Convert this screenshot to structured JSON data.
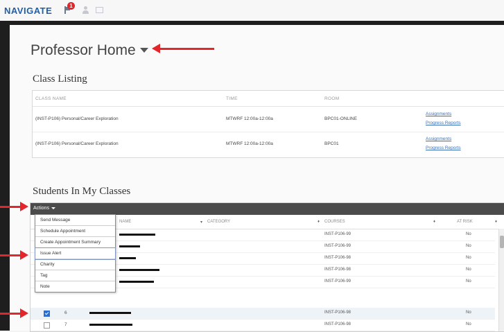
{
  "topbar": {
    "brand": "NAVIGATE",
    "badge_count": "1"
  },
  "header": {
    "title": "Professor Home"
  },
  "class_listing": {
    "title": "Class Listing",
    "columns": [
      "CLASS NAME",
      "TIME",
      "ROOM"
    ],
    "rows": [
      {
        "name": "(INST-P106) Personal/Career Exploration",
        "time": "MTWRF 12:00a-12:00a",
        "room": "BPC01-ONLINE",
        "link1": "Assignments",
        "link2": "Progress Reports"
      },
      {
        "name": "(INST-P106) Personal/Career Exploration",
        "time": "MTWRF 12:00a-12:00a",
        "room": "BPC01",
        "link1": "Assignments",
        "link2": "Progress Reports"
      }
    ]
  },
  "students": {
    "title": "Students In My Classes",
    "actions_label": "Actions",
    "columns": {
      "name": "NAME",
      "category": "CATEGORY",
      "courses": "COURSES",
      "at_risk": "AT RISK"
    },
    "rows": [
      {
        "num": "",
        "course": "INST-P106-99",
        "at_risk": "No",
        "checked": false
      },
      {
        "num": "",
        "course": "INST-P106-99",
        "at_risk": "No",
        "checked": false
      },
      {
        "num": "",
        "course": "INST-P106-98",
        "at_risk": "No",
        "checked": false
      },
      {
        "num": "",
        "course": "INST-P106-98",
        "at_risk": "No",
        "checked": false
      },
      {
        "num": "1",
        "course": "INST-P106-99",
        "at_risk": "No",
        "checked": false
      },
      {
        "num": "6",
        "course": "INST-P106-98",
        "at_risk": "No",
        "checked": true
      },
      {
        "num": "7",
        "course": "INST-P106-98",
        "at_risk": "No",
        "checked": false
      }
    ]
  },
  "actions_menu": {
    "items": [
      "Send Message",
      "Schedule Appointment",
      "Create Appointment Summary",
      "Issue Alert",
      "Charity",
      "Tag",
      "Note"
    ]
  },
  "colors": {
    "brand": "#1f5fa8",
    "arrow": "#e3262b",
    "toolbar": "#4b4b4b",
    "link": "#3a6fb5"
  }
}
